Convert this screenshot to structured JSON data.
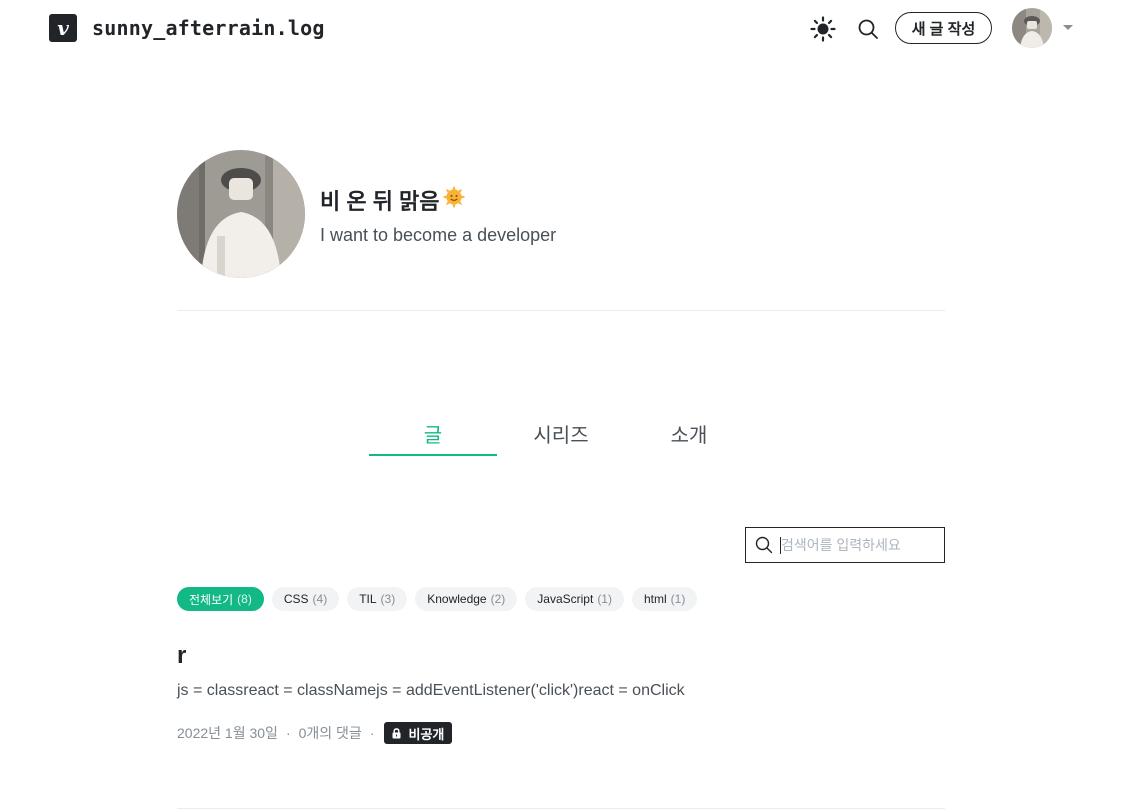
{
  "header": {
    "logo_text": "v",
    "blog_title": "sunny_afterrain.log",
    "theme_toggle_icon": "sun-icon",
    "search_icon": "search-icon",
    "write_button_label": "새 글 작성"
  },
  "profile": {
    "name": "비 온 뒤 맑음",
    "name_emoji": "🌞",
    "description": "I want to become a developer"
  },
  "tabs": [
    {
      "label": "글",
      "active": true
    },
    {
      "label": "시리즈",
      "active": false
    },
    {
      "label": "소개",
      "active": false
    }
  ],
  "search": {
    "placeholder": "검색어를 입력하세요"
  },
  "tags": [
    {
      "name": "전체보기",
      "count": "(8)",
      "active": true
    },
    {
      "name": "CSS",
      "count": "(4)",
      "active": false
    },
    {
      "name": "TIL",
      "count": "(3)",
      "active": false
    },
    {
      "name": "Knowledge",
      "count": "(2)",
      "active": false
    },
    {
      "name": "JavaScript",
      "count": "(1)",
      "active": false
    },
    {
      "name": "html",
      "count": "(1)",
      "active": false
    }
  ],
  "posts": [
    {
      "title": "r",
      "description": "js = classreact = classNamejs = addEventListener('click')react = onClick",
      "date": "2022년 1월 30일",
      "comments": "0개의 댓글",
      "separator": "·",
      "private_label": "비공개"
    }
  ],
  "colors": {
    "accent": "#12b886",
    "text": "#212529",
    "muted": "#868e96",
    "tag_bg": "#f1f3f5"
  }
}
